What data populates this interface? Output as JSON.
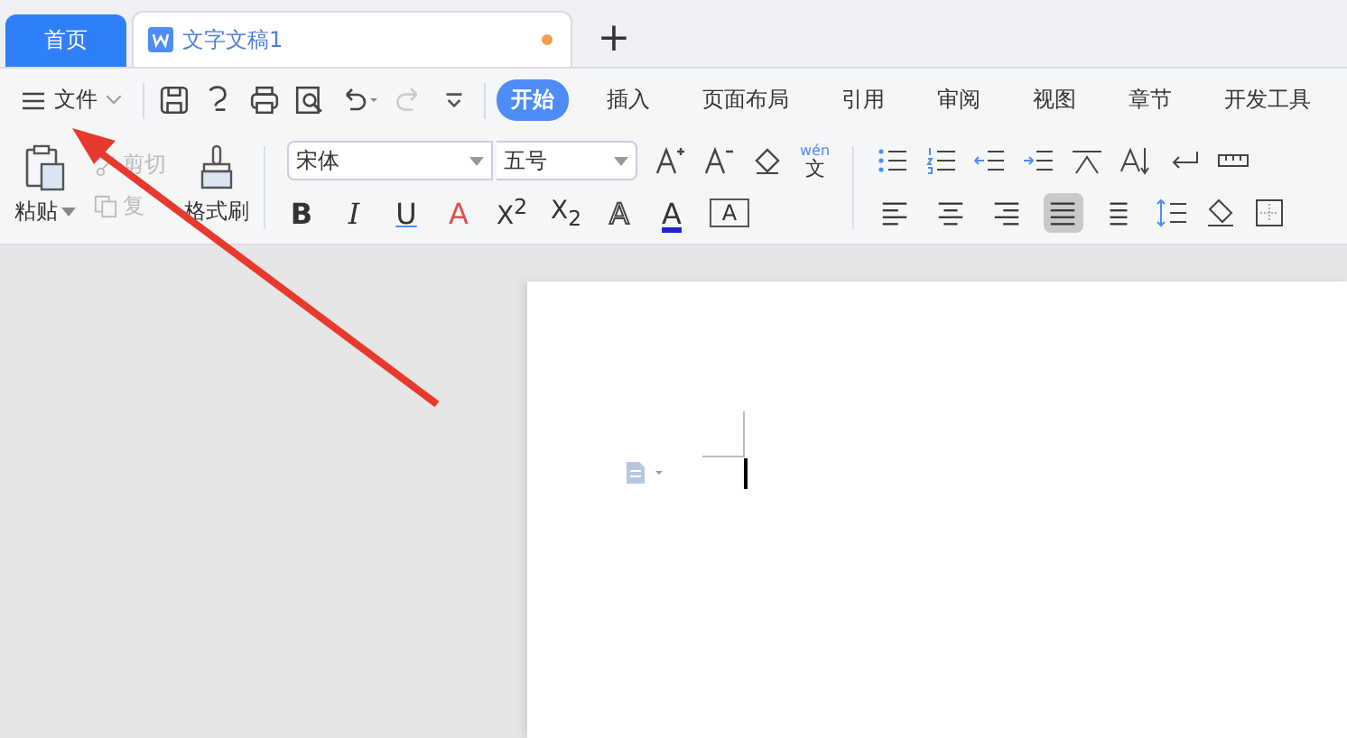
{
  "tabs": [
    {
      "label": "首页",
      "kind": "home",
      "selected": false
    },
    {
      "label": "文字文稿1",
      "kind": "doc",
      "selected": true,
      "modified": true
    }
  ],
  "new_tab": "+",
  "file_menu": "文件",
  "ribbon_tabs": [
    {
      "label": "开始",
      "selected": true
    },
    {
      "label": "插入",
      "selected": false
    },
    {
      "label": "页面布局",
      "selected": false
    },
    {
      "label": "引用",
      "selected": false
    },
    {
      "label": "审阅",
      "selected": false
    },
    {
      "label": "视图",
      "selected": false
    },
    {
      "label": "章节",
      "selected": false
    },
    {
      "label": "开发工具",
      "selected": false
    }
  ],
  "clipboard": {
    "paste": "粘贴",
    "cut": {
      "label": "剪切",
      "disabled": true
    },
    "copy": {
      "label": "复",
      "disabled": true
    },
    "format_painter": "格式刷"
  },
  "font": {
    "family": "宋体",
    "size": "五号",
    "phonetic": {
      "top": "wén",
      "bottom": "文"
    }
  },
  "format_buttons": [
    {
      "kind": "bold",
      "glyph": "B"
    },
    {
      "kind": "italic",
      "glyph": "I"
    },
    {
      "kind": "underline",
      "glyph": "U"
    },
    {
      "kind": "strike",
      "glyph": "A"
    },
    {
      "kind": "super",
      "glyph": "X$^{2}$"
    },
    {
      "kind": "sub",
      "glyph": "X$_{2}$"
    },
    {
      "kind": "effect",
      "glyph": "A"
    },
    {
      "kind": "color",
      "glyph": "A"
    },
    {
      "kind": "border",
      "glyph": "A"
    }
  ],
  "align_buttons": [
    {
      "kind": "left",
      "selected": false
    },
    {
      "kind": "center",
      "selected": false
    },
    {
      "kind": "right",
      "selected": false
    },
    {
      "kind": "justify",
      "selected": true
    },
    {
      "kind": "distribute",
      "selected": false
    }
  ]
}
